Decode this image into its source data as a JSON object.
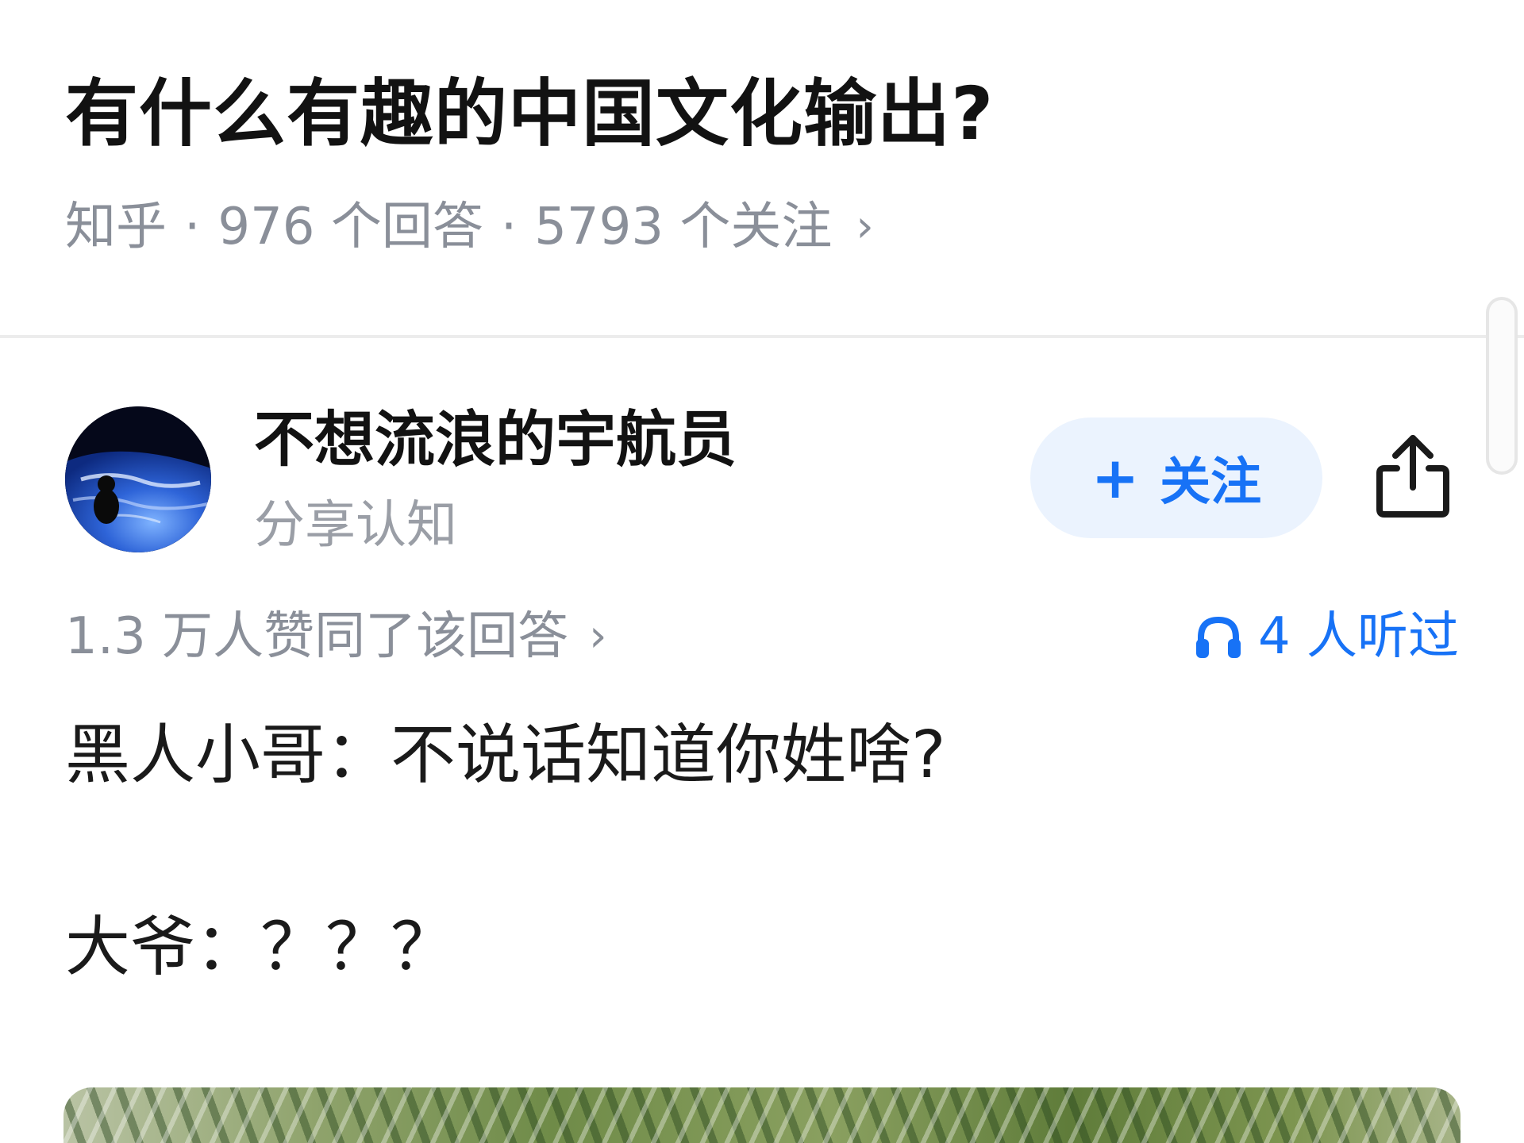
{
  "question": {
    "title": "有什么有趣的中国文化输出?",
    "source": "知乎",
    "separator": "·",
    "answers": "976 个回答",
    "followers": "5793 个关注",
    "chevron": "›"
  },
  "author": {
    "name": "不想流浪的宇航员",
    "subtitle": "分享认知",
    "avatar_icon": "astronaut-earth-avatar"
  },
  "actions": {
    "follow_plus": "+",
    "follow_label": "关注",
    "share_icon": "share-icon",
    "accent_color": "#1772f6"
  },
  "stats": {
    "likes": "1.3 万人赞同了该回答",
    "likes_chevron": "›",
    "listened": "4 人听过",
    "listened_icon": "headphones-icon"
  },
  "answer": {
    "line1": "黑人小哥：不说话知道你姓啥?",
    "line2": "大爷：？？？"
  }
}
